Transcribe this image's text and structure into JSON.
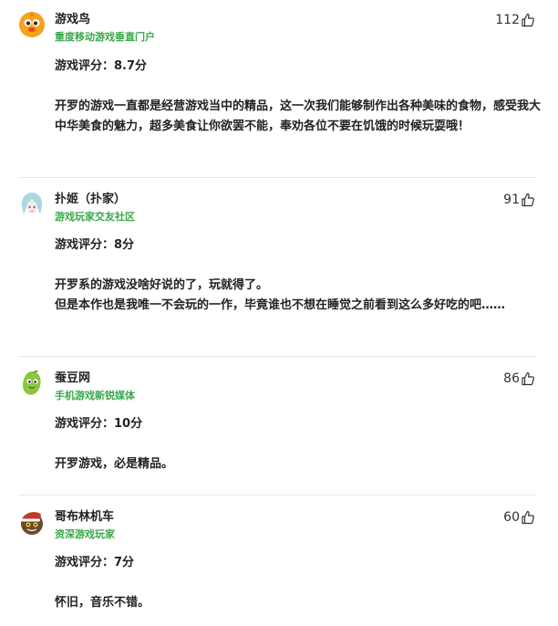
{
  "reviews": [
    {
      "author": "游戏鸟",
      "tagline": "重度移动游戏垂直门户",
      "likes": "112",
      "score": "游戏评分：8.7分",
      "body": [
        "开罗的游戏一直都是经营游戏当中的精品，这一次我们能够制作出各种美味的食物，感受我大中华美食的魅力，超多美食让你欲罢不能，奉劝各位不要在饥饿的时候玩耍哦！"
      ],
      "avatar_icon": "cartoon-bird-avatar",
      "avatar_color": "#f7a21c"
    },
    {
      "author": "扑姬（扑家）",
      "tagline": "游戏玩家交友社区",
      "likes": "91",
      "score": "游戏评分：8分",
      "body": [
        "开罗系的游戏没啥好说的了，玩就得了。",
        "但是本作也是我唯一不会玩的一作，毕竟谁也不想在睡觉之前看到这么多好吃的吧……"
      ],
      "avatar_icon": "anime-girl-avatar",
      "avatar_color": "#a8d8e0"
    },
    {
      "author": "蚕豆网",
      "tagline": "手机游戏新锐媒体",
      "likes": "86",
      "score": "游戏评分：10分",
      "body": [
        "开罗游戏，必是精品。"
      ],
      "avatar_icon": "green-bean-avatar",
      "avatar_color": "#8cc63f"
    },
    {
      "author": "哥布林机车",
      "tagline": "资深游戏玩家",
      "likes": "60",
      "score": "游戏评分：7分",
      "body": [
        "怀旧，音乐不错。"
      ],
      "avatar_icon": "goblin-santa-avatar",
      "avatar_color": "#c0392b"
    }
  ],
  "colors": {
    "tagline": "#3aa84a",
    "text": "#222222",
    "divider": "#e8e8e8"
  }
}
